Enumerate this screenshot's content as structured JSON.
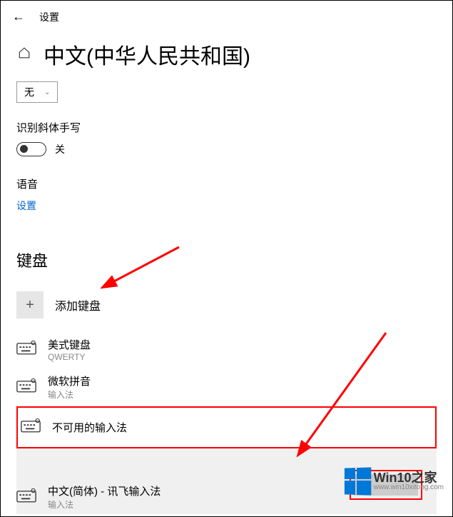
{
  "header": {
    "title": "设置"
  },
  "page": {
    "title": "中文(中华人民共和国)"
  },
  "dropdown": {
    "value": "无"
  },
  "handwriting": {
    "label": "识别斜体手写",
    "state": "关"
  },
  "speech": {
    "label": "语音",
    "link": "设置"
  },
  "keyboards": {
    "heading": "键盘",
    "add": "添加键盘",
    "items": [
      {
        "name": "美式键盘",
        "sub": "QWERTY"
      },
      {
        "name": "微软拼音",
        "sub": "输入法"
      },
      {
        "name": "不可用的输入法",
        "sub": ""
      },
      {
        "name": "中文(简体) - 讯飞输入法",
        "sub": "输入法"
      }
    ]
  },
  "watermark": {
    "title": "Win10之家",
    "url": "www.win10xitong.com"
  }
}
